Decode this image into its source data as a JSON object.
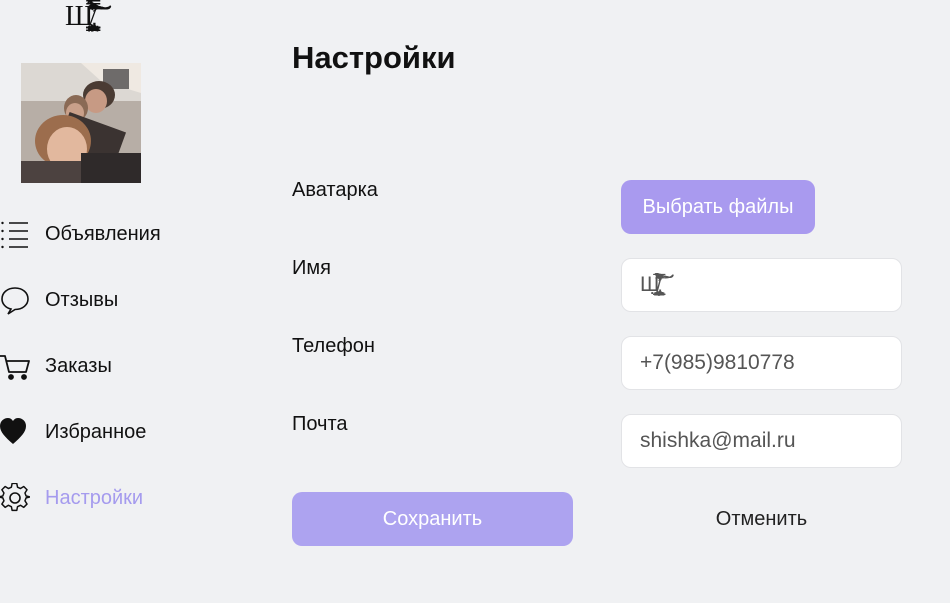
{
  "user": {
    "name": "Ш̸̢̨̛͇̤̲̣̮͍̦̖̻̱̯̺̥̗̲͖̥͓̦͓̝̪̫̹̳̣̮̻̞̙̗̫̿̏́͊̇̉͛͂̈́͒̋̀͘̕͝͠͠"
  },
  "sidebar": {
    "items": [
      {
        "label": "Объявления",
        "icon": "list-icon"
      },
      {
        "label": "Отзывы",
        "icon": "speech-bubble-icon"
      },
      {
        "label": "Заказы",
        "icon": "cart-icon"
      },
      {
        "label": "Избранное",
        "icon": "heart-icon"
      },
      {
        "label": "Настройки",
        "icon": "gear-icon",
        "active": true
      }
    ],
    "active_color": "#a59bee"
  },
  "page": {
    "title": "Настройки"
  },
  "form": {
    "avatar_label": "Аватарка",
    "avatar_button": "Выбрать файлы",
    "name_label": "Имя",
    "name_value": "Ш̸̢̨̛͇̤̲̣̮͍̦̖̻̱̯̺̥̗̲͖̥͓̦͓̝̪̫̹̳̣̮̻̞̙̗̫̿̏́͊̇̉͛͂̈́͒̋̀͘̕͝͠͠",
    "phone_label": "Телефон",
    "phone_value": "+7(985)9810778",
    "email_label": "Почта",
    "email_value": "shishka@mail.ru",
    "save_label": "Сохранить",
    "cancel_label": "Отменить"
  },
  "colors": {
    "accent": "#a99aef",
    "save_button": "#ada3f0",
    "background": "#f0f1f3"
  }
}
